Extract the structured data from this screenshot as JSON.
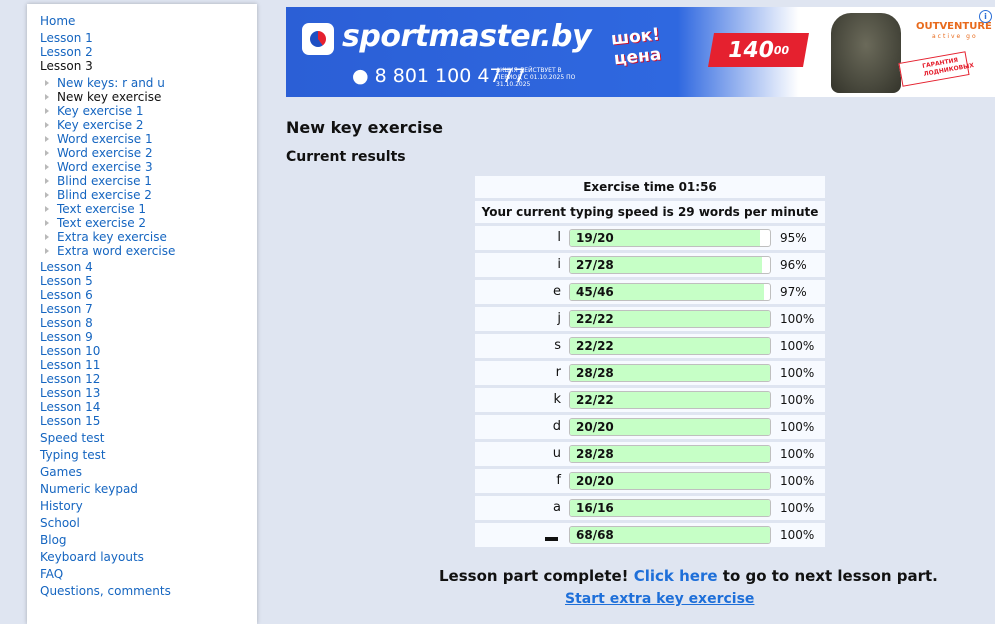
{
  "nav": {
    "home": "Home",
    "lesson1": "Lesson 1",
    "lesson2": "Lesson 2",
    "lesson3": "Lesson 3",
    "sub": [
      {
        "label": "New keys: r and u",
        "current": false
      },
      {
        "label": "New key exercise",
        "current": true
      },
      {
        "label": "Key exercise 1",
        "current": false
      },
      {
        "label": "Key exercise 2",
        "current": false
      },
      {
        "label": "Word exercise 1",
        "current": false
      },
      {
        "label": "Word exercise 2",
        "current": false
      },
      {
        "label": "Word exercise 3",
        "current": false
      },
      {
        "label": "Blind exercise 1",
        "current": false
      },
      {
        "label": "Blind exercise 2",
        "current": false
      },
      {
        "label": "Text exercise 1",
        "current": false
      },
      {
        "label": "Text exercise 2",
        "current": false
      },
      {
        "label": "Extra key exercise",
        "current": false
      },
      {
        "label": "Extra word exercise",
        "current": false
      }
    ],
    "lessons": [
      "Lesson 4",
      "Lesson 5",
      "Lesson 6",
      "Lesson 7",
      "Lesson 8",
      "Lesson 9",
      "Lesson 10",
      "Lesson 11",
      "Lesson 12",
      "Lesson 13",
      "Lesson 14",
      "Lesson 15"
    ],
    "extra": [
      "Speed test",
      "Typing test",
      "Games",
      "Numeric keypad",
      "History",
      "School",
      "Blog",
      "Keyboard layouts",
      "FAQ",
      "Questions, comments"
    ]
  },
  "banner": {
    "brand": "sportmaster.by",
    "phone": "8 801 100 4777",
    "fine_print": "АКЦИЯ ДЕЙСТВУЕТ В ПЕРИОД С 01.10.2025 ПО 31.10.2025",
    "shock_line1": "шок!",
    "shock_line2": "цена",
    "price": "140",
    "price_cents": "00",
    "partner": "OUTVENTURE",
    "partner_sub": "active go",
    "guarantee": "ГАРАНТИЯ ЛОДНИКОВЫХ",
    "info": "i"
  },
  "page": {
    "title": "New key exercise",
    "subtitle": "Current results",
    "exercise_time": "Exercise time 01:56",
    "speed": "Your current typing speed is 29 words per minute"
  },
  "results": [
    {
      "key": "l",
      "done": 19,
      "total": 20,
      "fraction": "19/20",
      "percent": "95%",
      "fill": 0.95
    },
    {
      "key": "i",
      "done": 27,
      "total": 28,
      "fraction": "27/28",
      "percent": "96%",
      "fill": 0.96
    },
    {
      "key": "e",
      "done": 45,
      "total": 46,
      "fraction": "45/46",
      "percent": "97%",
      "fill": 0.97
    },
    {
      "key": "j",
      "done": 22,
      "total": 22,
      "fraction": "22/22",
      "percent": "100%",
      "fill": 1.0
    },
    {
      "key": "s",
      "done": 22,
      "total": 22,
      "fraction": "22/22",
      "percent": "100%",
      "fill": 1.0
    },
    {
      "key": "r",
      "done": 28,
      "total": 28,
      "fraction": "28/28",
      "percent": "100%",
      "fill": 1.0
    },
    {
      "key": "k",
      "done": 22,
      "total": 22,
      "fraction": "22/22",
      "percent": "100%",
      "fill": 1.0
    },
    {
      "key": "d",
      "done": 20,
      "total": 20,
      "fraction": "20/20",
      "percent": "100%",
      "fill": 1.0
    },
    {
      "key": "u",
      "done": 28,
      "total": 28,
      "fraction": "28/28",
      "percent": "100%",
      "fill": 1.0
    },
    {
      "key": "f",
      "done": 20,
      "total": 20,
      "fraction": "20/20",
      "percent": "100%",
      "fill": 1.0
    },
    {
      "key": "a",
      "done": 16,
      "total": 16,
      "fraction": "16/16",
      "percent": "100%",
      "fill": 1.0
    },
    {
      "key": "space",
      "done": 68,
      "total": 68,
      "fraction": "68/68",
      "percent": "100%",
      "fill": 1.0
    }
  ],
  "footer": {
    "complete_text": "Lesson part complete!",
    "click_here": "Click here",
    "complete_tail": "to go to next lesson part.",
    "extra_link": "Start extra key exercise"
  }
}
